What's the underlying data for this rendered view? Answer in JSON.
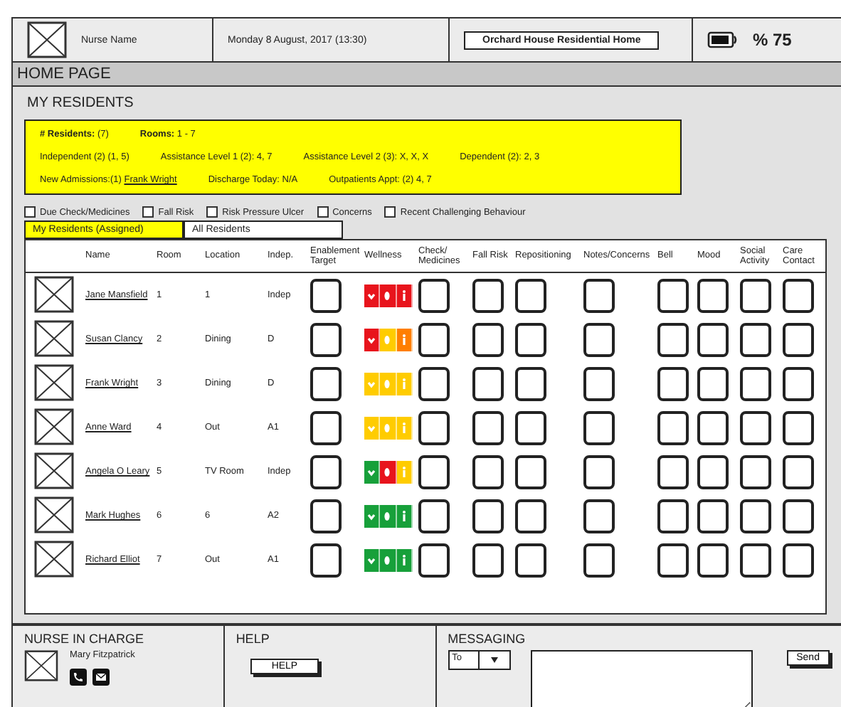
{
  "header": {
    "nurse_name": "Nurse Name",
    "date": "Monday 8 August, 2017 (13:30)",
    "home_name": "Orchard House Residential Home",
    "battery": "% 75"
  },
  "page_title": "HOME PAGE",
  "section_title": "MY RESIDENTS",
  "summary": {
    "lines": [
      [
        {
          "text": "**# Residents:**  (7)"
        },
        {
          "text": "**Rooms:**  1 - 7"
        }
      ],
      [
        {
          "text": "Independent (2) (1, 5)"
        },
        {
          "text": "Assistance Level 1 (2): 4, 7"
        },
        {
          "text": "Assistance Level 2 (3): X, X, X"
        },
        {
          "text": "Dependent (2): 2, 3"
        }
      ],
      [
        {
          "text": "New Admissions:(1)",
          "link": "Frank Wright"
        },
        {
          "text": "Discharge Today: N/A"
        },
        {
          "text": "Outpatients Appt: (2) 4, 7"
        }
      ]
    ]
  },
  "filters": [
    {
      "label": "Due Check/Medicines",
      "checked": false
    },
    {
      "label": "Fall Risk",
      "checked": false
    },
    {
      "label": "Risk Pressure Ulcer",
      "checked": false
    },
    {
      "label": "Concerns",
      "checked": false
    },
    {
      "label": "Recent Challenging Behaviour",
      "checked": false
    }
  ],
  "tabs": [
    {
      "label": "My Residents (Assigned)",
      "selected": true
    },
    {
      "label": "All Residents",
      "selected": false
    }
  ],
  "table": {
    "columns": [
      {
        "kind": "avatar"
      },
      {
        "label": "Name",
        "kind": "name"
      },
      {
        "label": "Room",
        "kind": "room"
      },
      {
        "label": "Location",
        "kind": "location"
      },
      {
        "label": "Indep.",
        "kind": "indep"
      },
      {
        "label": "Enablement Target",
        "kind": "box"
      },
      {
        "label": "Wellness",
        "kind": "wellness"
      },
      {
        "label": "Check/ Medicines",
        "kind": "box"
      },
      {
        "label": "Fall Risk",
        "kind": "box"
      },
      {
        "label": "Repositioning",
        "kind": "box"
      },
      {
        "label": "Notes/Concerns",
        "kind": "box"
      },
      {
        "label": "Bell",
        "kind": "box"
      },
      {
        "label": "Mood",
        "kind": "box"
      },
      {
        "label": "Social Activity",
        "kind": "box"
      },
      {
        "label": "Care Contact",
        "kind": "box"
      }
    ],
    "rows": [
      {
        "name": "Jane Mansfield",
        "room": "1",
        "location": "1",
        "indep": "Indep",
        "wellness": [
          {
            "color": "#e8141c"
          },
          {
            "color": "#e8141c"
          },
          {
            "color": "#e8141c"
          }
        ]
      },
      {
        "name": "Susan Clancy",
        "room": "2",
        "location": "Dining",
        "indep": "D",
        "wellness": [
          {
            "color": "#e8141c"
          },
          {
            "color": "#ffcc00"
          },
          {
            "color": "#ff7f00"
          }
        ]
      },
      {
        "name": "Frank Wright",
        "room": "3",
        "location": "Dining",
        "indep": "D",
        "wellness": [
          {
            "color": "#ffcc00"
          },
          {
            "color": "#ffcc00"
          },
          {
            "color": "#ffcc00"
          }
        ]
      },
      {
        "name": "Anne Ward",
        "room": "4",
        "location": "Out",
        "indep": "A1",
        "wellness": [
          {
            "color": "#ffcc00"
          },
          {
            "color": "#ffcc00"
          },
          {
            "color": "#ffcc00"
          }
        ]
      },
      {
        "name": "Angela O Leary",
        "room": "5",
        "location": "TV Room",
        "indep": "Indep",
        "wellness": [
          {
            "color": "#17a03a"
          },
          {
            "color": "#e8141c"
          },
          {
            "color": "#ffcc00"
          }
        ]
      },
      {
        "name": "Mark Hughes",
        "room": "6",
        "location": "6",
        "indep": "A2",
        "wellness": [
          {
            "color": "#17a03a"
          },
          {
            "color": "#17a03a"
          },
          {
            "color": "#17a03a"
          }
        ]
      },
      {
        "name": "Richard Elliot",
        "room": "7",
        "location": "Out",
        "indep": "A1",
        "wellness": [
          {
            "color": "#17a03a"
          },
          {
            "color": "#17a03a"
          },
          {
            "color": "#17a03a"
          }
        ]
      }
    ]
  },
  "nurse_in_charge": {
    "title": "NURSE IN CHARGE",
    "name": "Mary Fitzpatrick"
  },
  "help": {
    "title": "HELP",
    "button": "HELP"
  },
  "messaging": {
    "title": "MESSAGING",
    "recipient": "To",
    "button": "Send"
  }
}
